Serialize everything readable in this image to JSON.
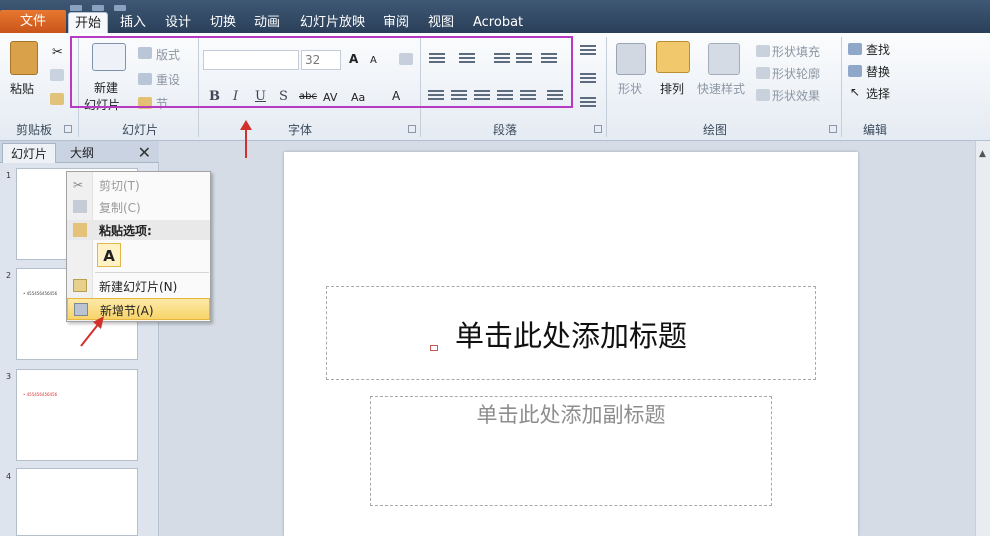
{
  "tabs": {
    "file": "文件",
    "items": [
      "开始",
      "插入",
      "设计",
      "切换",
      "动画",
      "幻灯片放映",
      "审阅",
      "视图",
      "Acrobat"
    ]
  },
  "ribbon": {
    "clipboard": {
      "paste": "粘贴",
      "group": "剪贴板"
    },
    "slides": {
      "new_slide_1": "新建",
      "new_slide_2": "幻灯片",
      "layout": "版式",
      "reset": "重设",
      "section": "节",
      "group": "幻灯片"
    },
    "font": {
      "size": "32",
      "bold": "B",
      "italic": "I",
      "underline": "U",
      "strike": "S",
      "group": "字体"
    },
    "paragraph": {
      "group": "段落"
    },
    "drawing": {
      "shape": "形状",
      "arrange": "排列",
      "quick_style": "快速样式",
      "fill": "形状填充",
      "outline": "形状轮廓",
      "effect": "形状效果",
      "group": "绘图"
    },
    "editing": {
      "find": "查找",
      "replace": "替换",
      "select": "选择",
      "group": "编辑"
    }
  },
  "pane": {
    "tab_slides": "幻灯片",
    "tab_outline": "大纲",
    "close": "✕",
    "thumbs": [
      {
        "num": "1",
        "text": ""
      },
      {
        "num": "2",
        "text": "• 455456456456"
      },
      {
        "num": "3",
        "text": "• 455456456456"
      },
      {
        "num": "4",
        "text": ""
      }
    ]
  },
  "context_menu": {
    "cut": "剪切(T)",
    "copy": "复制(C)",
    "paste_options": "粘贴选项:",
    "paste_a": "A",
    "new_slide": "新建幻灯片(N)",
    "add_section": "新增节(A)"
  },
  "slide": {
    "title_placeholder": "单击此处添加标题",
    "subtitle_placeholder": "单击此处添加副标题"
  },
  "colors": {
    "highlight_box": "#b53bc3",
    "annotation_arrow": "#d2312b",
    "file_tab": "#d9622a",
    "thumb3_text": "#d33"
  }
}
